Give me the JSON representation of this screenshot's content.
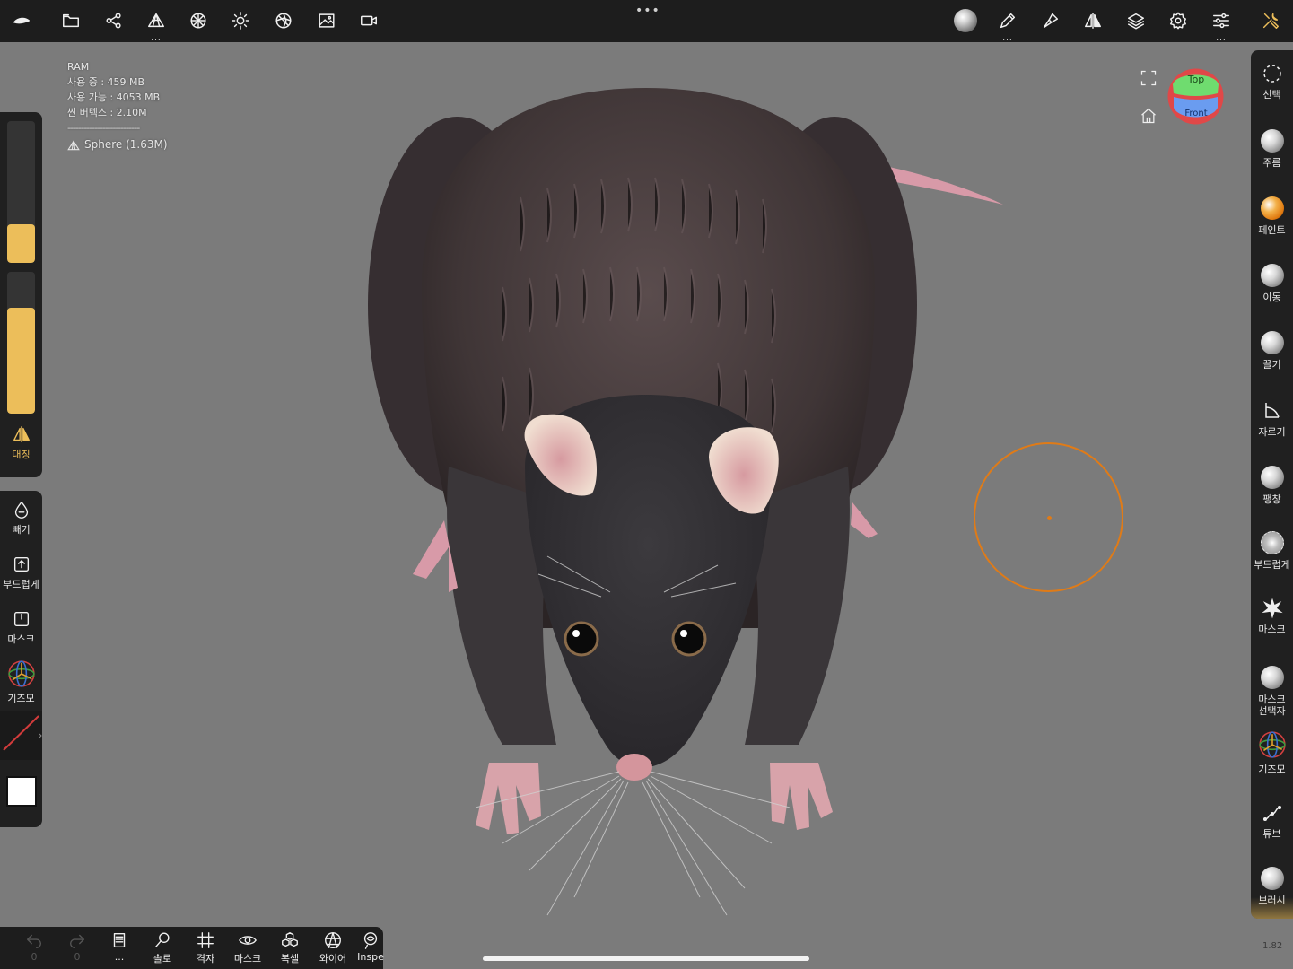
{
  "top_toolbar": {
    "left_icons": [
      "logo-icon",
      "folder-icon",
      "share-icon",
      "mesh-icon",
      "topology-icon",
      "light-icon",
      "shading-icon",
      "background-image-icon",
      "camera-icon"
    ],
    "right_icons": [
      "material-icon",
      "brush-pen-icon",
      "paint-brush-icon",
      "symmetry-icon",
      "layers-icon",
      "settings-icon",
      "sliders-icon",
      "tools-icon"
    ],
    "more_dots": "•••",
    "small_dots": "..."
  },
  "stats": {
    "ram_label": "RAM",
    "used": "사용 중 : 459 MB",
    "available": "사용 가능 : 4053 MB",
    "vertices": "씬 버텍스 : 2.10M",
    "separator": "---------------------------",
    "mesh": "Sphere (1.63M)"
  },
  "left_panel": {
    "radius_slider_value": 0.27,
    "intensity_slider_value": 0.75,
    "symmetry_label": "대칭",
    "subtract_label": "빼기",
    "smooth_label": "부드럽게",
    "mask_label": "마스크",
    "gizmo_label": "기즈모"
  },
  "right_panel": {
    "tools": [
      {
        "label": "선택",
        "icon": "select-icon"
      },
      {
        "label": "주름",
        "icon": "crease-icon"
      },
      {
        "label": "페인트",
        "icon": "paint-icon"
      },
      {
        "label": "이동",
        "icon": "move-icon"
      },
      {
        "label": "끌기",
        "icon": "drag-icon"
      },
      {
        "label": "자르기",
        "icon": "trim-icon"
      },
      {
        "label": "팽창",
        "icon": "inflate-icon"
      },
      {
        "label": "부드럽게",
        "icon": "smooth-icon"
      },
      {
        "label": "마스크",
        "icon": "mask-icon"
      },
      {
        "label": "마스크 선택자",
        "icon": "mask-selector-icon"
      },
      {
        "label": "기즈모",
        "icon": "gizmo-icon"
      },
      {
        "label": "튜브",
        "icon": "tube-icon"
      },
      {
        "label": "브러시",
        "icon": "brush-icon"
      }
    ]
  },
  "nav_cube": {
    "top_label": "Top",
    "front_label": "Front",
    "colors": {
      "top": "#6fdc6f",
      "front": "#6a9cf0",
      "side": "#e04848"
    }
  },
  "bottom_toolbar": {
    "undo_count": "0",
    "redo_count": "0",
    "history_dots": "...",
    "solo_label": "솔로",
    "grid_label": "격자",
    "mask_label": "마스크",
    "duplicate_label": "복셀",
    "wireframe_label": "와이어",
    "inspect_label": "Inspe"
  },
  "version": "1.82",
  "colors": {
    "accent": "#ecbe5a",
    "brush_cursor": "#e07b17",
    "background": "#7b7b7b",
    "panel": "#202020"
  }
}
